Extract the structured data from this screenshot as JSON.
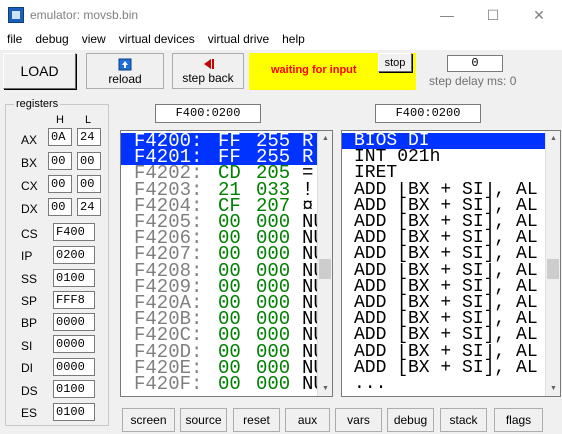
{
  "window": {
    "title": "emulator: movsb.bin",
    "minimize": "—",
    "maximize": "☐",
    "close": "✕"
  },
  "menu": [
    "file",
    "debug",
    "view",
    "virtual devices",
    "virtual drive",
    "help"
  ],
  "toolbar": {
    "load": "LOAD",
    "reload": "reload",
    "step_back": "step back",
    "status": "waiting for input",
    "stop": "stop",
    "step_delay_value": "0",
    "step_delay_label": "step delay ms: 0"
  },
  "registers": {
    "caption": "registers",
    "h_label": "H",
    "l_label": "L",
    "split": [
      {
        "name": "AX",
        "h": "0A",
        "l": "24"
      },
      {
        "name": "BX",
        "h": "00",
        "l": "00"
      },
      {
        "name": "CX",
        "h": "00",
        "l": "00"
      },
      {
        "name": "DX",
        "h": "00",
        "l": "24"
      }
    ],
    "full": [
      {
        "name": "CS",
        "value": "F400"
      },
      {
        "name": "IP",
        "value": "0200"
      },
      {
        "name": "SS",
        "value": "0100"
      },
      {
        "name": "SP",
        "value": "FFF8"
      },
      {
        "name": "BP",
        "value": "0000"
      },
      {
        "name": "SI",
        "value": "0000"
      },
      {
        "name": "DI",
        "value": "0000"
      },
      {
        "name": "DS",
        "value": "0100"
      },
      {
        "name": "ES",
        "value": "0100"
      }
    ]
  },
  "memory": {
    "address": "F400:0200",
    "rows": [
      {
        "addr": "F4200:",
        "hex": "FF",
        "dec": "255",
        "chr": "R",
        "selected": true
      },
      {
        "addr": "F4201:",
        "hex": "FF",
        "dec": "255",
        "chr": "R",
        "selected": true
      },
      {
        "addr": "F4202:",
        "hex": "CD",
        "dec": "205",
        "chr": "="
      },
      {
        "addr": "F4203:",
        "hex": "21",
        "dec": "033",
        "chr": "!"
      },
      {
        "addr": "F4204:",
        "hex": "CF",
        "dec": "207",
        "chr": "¤"
      },
      {
        "addr": "F4205:",
        "hex": "00",
        "dec": "000",
        "chr": "NU"
      },
      {
        "addr": "F4206:",
        "hex": "00",
        "dec": "000",
        "chr": "NU"
      },
      {
        "addr": "F4207:",
        "hex": "00",
        "dec": "000",
        "chr": "NU"
      },
      {
        "addr": "F4208:",
        "hex": "00",
        "dec": "000",
        "chr": "NU"
      },
      {
        "addr": "F4209:",
        "hex": "00",
        "dec": "000",
        "chr": "NU"
      },
      {
        "addr": "F420A:",
        "hex": "00",
        "dec": "000",
        "chr": "NU"
      },
      {
        "addr": "F420B:",
        "hex": "00",
        "dec": "000",
        "chr": "NU"
      },
      {
        "addr": "F420C:",
        "hex": "00",
        "dec": "000",
        "chr": "NU"
      },
      {
        "addr": "F420D:",
        "hex": "00",
        "dec": "000",
        "chr": "NU"
      },
      {
        "addr": "F420E:",
        "hex": "00",
        "dec": "000",
        "chr": "NU"
      },
      {
        "addr": "F420F:",
        "hex": "00",
        "dec": "000",
        "chr": "NU"
      }
    ]
  },
  "disassembly": {
    "address": "F400:0200",
    "rows": [
      {
        "text": "BIOS DI",
        "selected": true
      },
      {
        "text": "INT 021h"
      },
      {
        "text": "IRET"
      },
      {
        "text": "ADD [BX + SI], AL"
      },
      {
        "text": "ADD [BX + SI], AL"
      },
      {
        "text": "ADD [BX + SI], AL"
      },
      {
        "text": "ADD [BX + SI], AL"
      },
      {
        "text": "ADD [BX + SI], AL"
      },
      {
        "text": "ADD [BX + SI], AL"
      },
      {
        "text": "ADD [BX + SI], AL"
      },
      {
        "text": "ADD [BX + SI], AL"
      },
      {
        "text": "ADD [BX + SI], AL"
      },
      {
        "text": "ADD [BX + SI], AL"
      },
      {
        "text": "ADD [BX + SI], AL"
      },
      {
        "text": "ADD [BX + SI], AL"
      },
      {
        "text": "..."
      }
    ]
  },
  "bottom_buttons": [
    "screen",
    "source",
    "reset",
    "aux",
    "vars",
    "debug",
    "stack",
    "flags"
  ],
  "colors": {
    "selection": "#0033ff",
    "hex_green": "#008000",
    "status_bg": "#ffff00",
    "status_text": "#ff0000"
  }
}
